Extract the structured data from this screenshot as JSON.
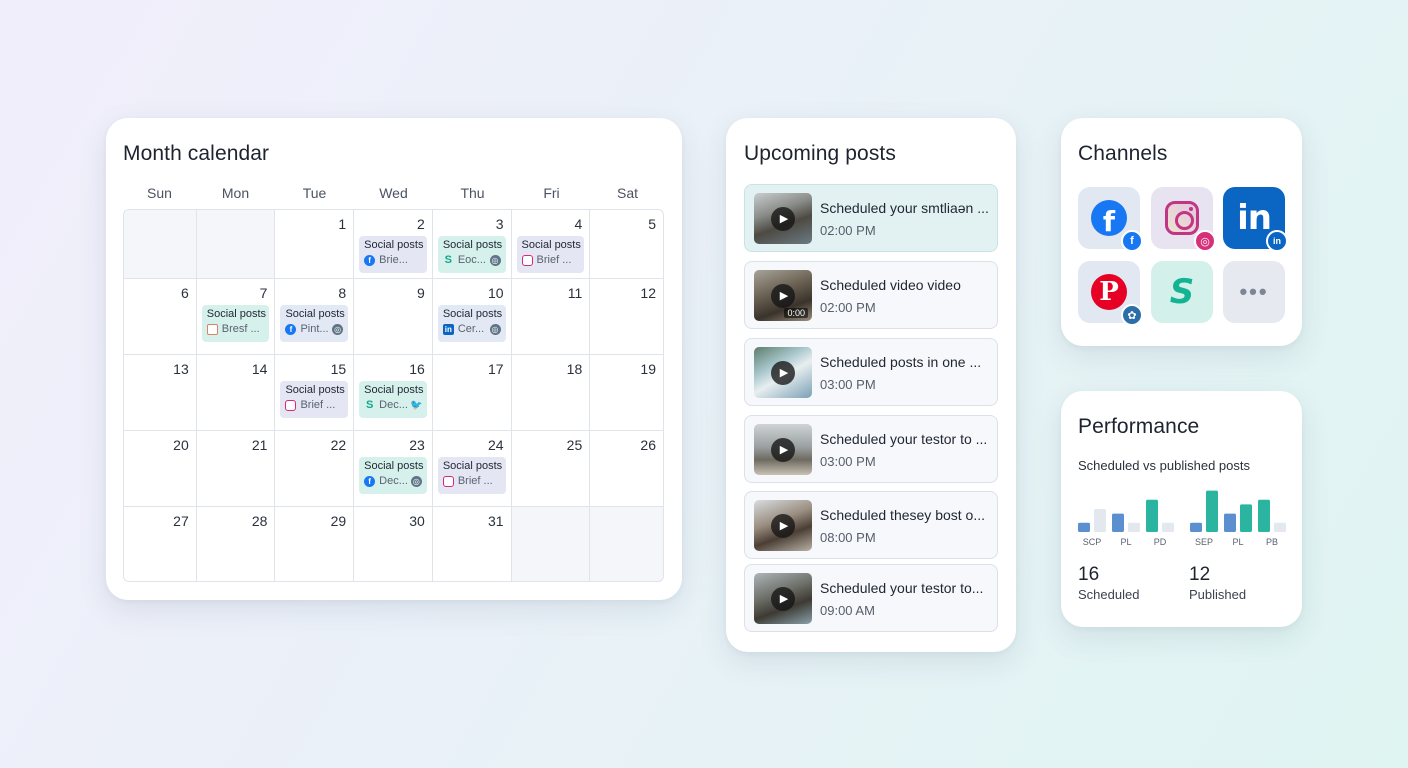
{
  "calendar": {
    "title": "Month calendar",
    "weekdays": [
      "Sun",
      "Mon",
      "Tue",
      "Wed",
      "Thu",
      "Fri",
      "Sat"
    ],
    "weeks": [
      [
        {
          "day": "",
          "muted": true
        },
        {
          "day": "",
          "muted": true
        },
        {
          "day": "1"
        },
        {
          "day": "2",
          "event": {
            "title": "Social posts",
            "text": "Brie...",
            "icon": "facebook-icon",
            "tone": "lav"
          }
        },
        {
          "day": "3",
          "event": {
            "title": "Social posts",
            "text": "Eoc...",
            "icon": "s-brand-icon",
            "badge": "globe-icon",
            "tone": "teal"
          }
        },
        {
          "day": "4",
          "event": {
            "title": "Social posts",
            "text": "Brief ...",
            "icon": "instagram-icon",
            "tone": "lav"
          }
        },
        {
          "day": "5"
        }
      ],
      [
        {
          "day": "6"
        },
        {
          "day": "7",
          "event": {
            "title": "Social posts",
            "text": "Bresf ...",
            "icon": "image-icon",
            "tone": "teal"
          }
        },
        {
          "day": "8",
          "event": {
            "title": "Social posts",
            "text": "Pint...",
            "icon": "facebook-icon",
            "badge": "globe-icon",
            "tone": "blue"
          }
        },
        {
          "day": "9"
        },
        {
          "day": "10",
          "event": {
            "title": "Social posts",
            "text": "Cer...",
            "icon": "linkedin-icon",
            "badge": "globe-icon",
            "tone": "blue"
          }
        },
        {
          "day": "11"
        },
        {
          "day": "12"
        }
      ],
      [
        {
          "day": "13"
        },
        {
          "day": "14"
        },
        {
          "day": "15",
          "event": {
            "title": "Social posts",
            "text": "Brief ...",
            "icon": "instagram-icon",
            "tone": "lav"
          }
        },
        {
          "day": "16",
          "event": {
            "title": "Social posts",
            "text": "Dec...",
            "icon": "s-brand-icon",
            "badge": "twitter-icon",
            "tone": "teal"
          }
        },
        {
          "day": "17"
        },
        {
          "day": "18"
        },
        {
          "day": "19"
        }
      ],
      [
        {
          "day": "20"
        },
        {
          "day": "21"
        },
        {
          "day": "22"
        },
        {
          "day": "23",
          "event": {
            "title": "Social posts",
            "text": "Dec...",
            "icon": "facebook-icon",
            "badge": "globe-icon",
            "tone": "teal"
          }
        },
        {
          "day": "24",
          "event": {
            "title": "Social posts",
            "text": "Brief ...",
            "icon": "instagram-icon",
            "tone": "lav"
          }
        },
        {
          "day": "25"
        },
        {
          "day": "26"
        }
      ],
      [
        {
          "day": "27"
        },
        {
          "day": "28"
        },
        {
          "day": "29"
        },
        {
          "day": "30"
        },
        {
          "day": "31"
        },
        {
          "day": "",
          "muted": true
        },
        {
          "day": "",
          "muted": true
        }
      ]
    ]
  },
  "upcoming": {
    "title": "Upcoming posts",
    "posts": [
      {
        "title": "Scheduled your smtliaən ...",
        "time": "02:00 PM",
        "active": true,
        "thumb": "cliff"
      },
      {
        "title": "Scheduled video video",
        "time": "02:00 PM",
        "duration": "0:00",
        "thumb": "rocks"
      },
      {
        "title": "Scheduled posts in one ...",
        "time": "03:00 PM",
        "thumb": "wave"
      },
      {
        "title": "Scheduled your testor to ...",
        "time": "03:00 PM",
        "thumb": "beach"
      },
      {
        "title": "Scheduled thesey bost o...",
        "time": "08:00 PM",
        "thumb": "person"
      },
      {
        "title": "Scheduled your testor to...",
        "time": "09:00 AM",
        "thumb": "coast"
      }
    ]
  },
  "channels": {
    "title": "Channels",
    "items": [
      {
        "name": "facebook",
        "icon": "facebook-icon"
      },
      {
        "name": "instagram",
        "icon": "instagram-icon"
      },
      {
        "name": "linkedin",
        "icon": "linkedin-icon"
      },
      {
        "name": "pinterest",
        "icon": "pinterest-icon"
      },
      {
        "name": "s-brand",
        "icon": "s-brand-icon"
      },
      {
        "name": "more",
        "icon": "more-dots-icon"
      }
    ]
  },
  "performance": {
    "title": "Performance",
    "subtitle": "Scheduled vs published posts",
    "scheduled_value": "16",
    "scheduled_label": "Scheduled",
    "published_value": "12",
    "published_label": "Published"
  },
  "chart_data": {
    "type": "bar",
    "title": "Scheduled vs published posts",
    "groups": [
      {
        "labels": [
          "SCP",
          "PL",
          "PD"
        ],
        "bars": [
          [
            2,
            5
          ],
          [
            4,
            2
          ],
          [
            7,
            2
          ]
        ]
      },
      {
        "labels": [
          "SEP",
          "PL",
          "PB"
        ],
        "bars": [
          [
            2,
            9
          ],
          [
            4,
            6
          ],
          [
            7,
            2
          ]
        ]
      }
    ],
    "colors": {
      "scheduled": "#5b8fd0",
      "published": "#2bb5a0",
      "muted": "#e3e7ee"
    },
    "ylim": [
      0,
      10
    ]
  }
}
